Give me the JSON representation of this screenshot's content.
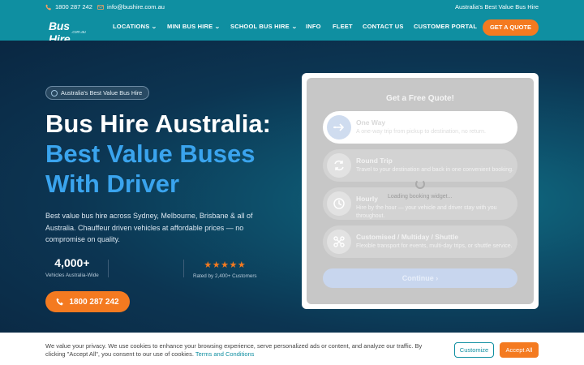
{
  "topbar": {
    "phone": "1800 287 242",
    "email": "info@bushire.com.au",
    "tagline": "Australia's Best Value Bus Hire"
  },
  "logo": {
    "word": "Bus Hire",
    "sub": ".com.au"
  },
  "nav": {
    "items": [
      "LOCATIONS",
      "MINI BUS HIRE",
      "SCHOOL BUS HIRE",
      "INFO",
      "FLEET",
      "CONTACT US",
      "CUSTOMER PORTAL"
    ],
    "cta": "GET A QUOTE"
  },
  "hero": {
    "badge": "Australia's Best Value Bus Hire",
    "headline_1": "Bus Hire Australia:",
    "headline_2": "Best Value Buses",
    "headline_3": "With Driver",
    "description": "Best value bus hire across Sydney, Melbourne, Brisbane & all of Australia. Chauffeur driven vehicles at affordable prices — no compromise on quality.",
    "stat_number": "4,000+",
    "stat_label": "Vehicles Australia-Wide",
    "rating_stars": "★★★★★",
    "rating_label": "Rated by 2,400+ Customers",
    "phone_button": "1800 287 242"
  },
  "quote": {
    "title": "Get a Free Quote!",
    "options": [
      {
        "name": "One Way",
        "desc": "A one-way trip from pickup to destination, no return.",
        "icon": "arrow-right-icon"
      },
      {
        "name": "Round Trip",
        "desc": "Travel to your destination and back in one convenient booking.",
        "icon": "round-trip-icon"
      },
      {
        "name": "Hourly",
        "desc": "Hire by the hour — your vehicle and driver stay with you throughout.",
        "icon": "clock-icon"
      },
      {
        "name": "Customised / Multiday / Shuttle",
        "desc": "Flexible transport for events, multi-day trips, or shuttle service.",
        "icon": "route-icon"
      }
    ],
    "loading": "Loading booking widget...",
    "continue": "Continue ›"
  },
  "cookie": {
    "text": "We value your privacy. We use cookies to enhance your browsing experience, serve personalized ads or content, and analyze our traffic. By clicking \"Accept All\", you consent to our use of cookies.",
    "link": "Terms and Conditions",
    "customize": "Customize",
    "accept": "Accept All"
  },
  "colors": {
    "teal": "#0f8fa1",
    "orange": "#f47a20",
    "accent_blue": "#3aa4ee",
    "navy": "#0a2742"
  }
}
